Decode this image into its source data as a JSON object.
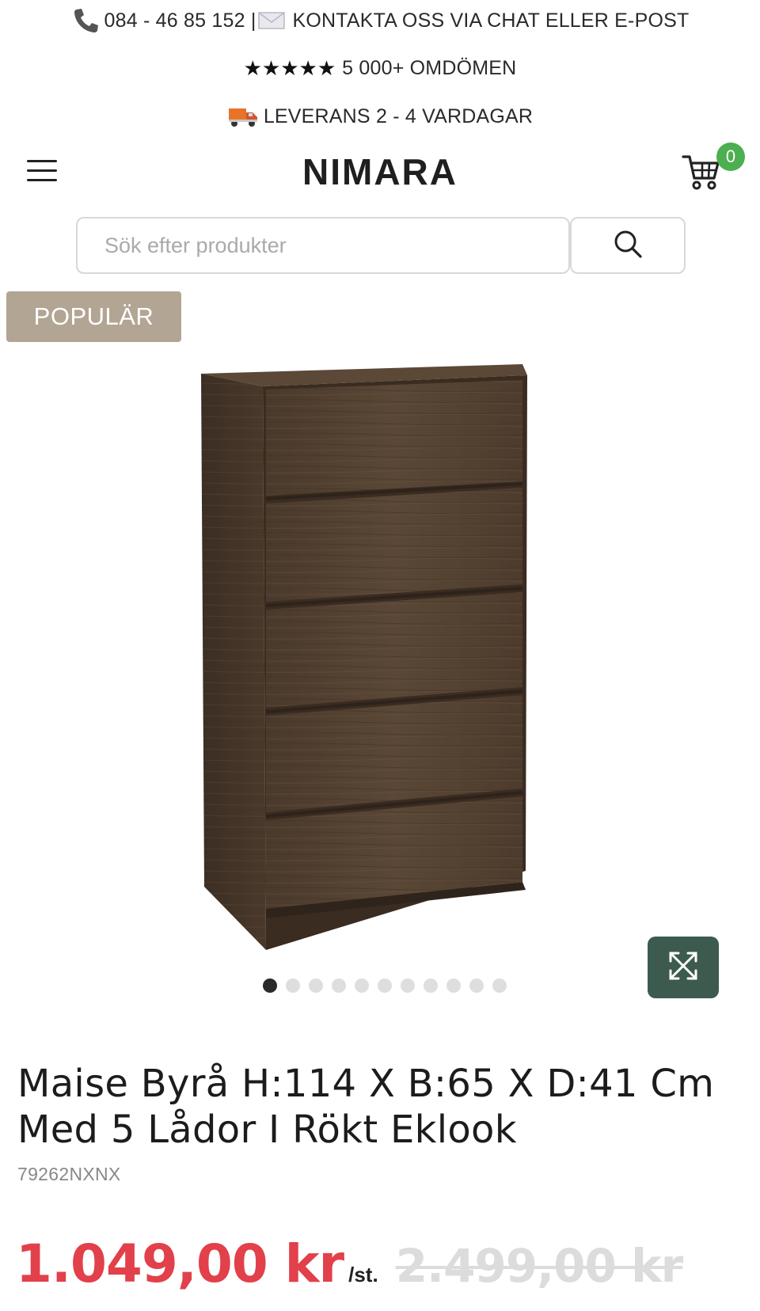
{
  "topbar": {
    "phone": "084 - 46 85 152 |",
    "contact": "KONTAKTA OSS VIA CHAT ELLER E-POST",
    "stars": "★★★★★",
    "reviews": "5 000+ OMDÖMEN",
    "delivery": "LEVERANS 2 - 4 VARDAGAR"
  },
  "header": {
    "logo": "NIMARA",
    "cart_count": "0"
  },
  "search": {
    "placeholder": "Sök efter produkter"
  },
  "product": {
    "badge": "POPULÄR",
    "title_line1": "Maise Byrå H:114 X B:65 X D:41 Cm",
    "title_line2": "Med 5 Lådor I Rökt Eklook",
    "sku": "79262NXNX",
    "price_now": "1.049,00 kr",
    "price_unit": "/st.",
    "price_old": "2.499,00 kr",
    "gallery_total": 11,
    "gallery_active": 1
  },
  "colors": {
    "accent_price": "#e2404a",
    "badge_bg": "#b3a593",
    "expand_bg": "#3d5a4e",
    "cart_badge": "#4caf50"
  },
  "icons": [
    "phone-icon",
    "mail-icon",
    "truck-icon",
    "menu-icon",
    "cart-icon",
    "search-icon",
    "expand-icon"
  ]
}
